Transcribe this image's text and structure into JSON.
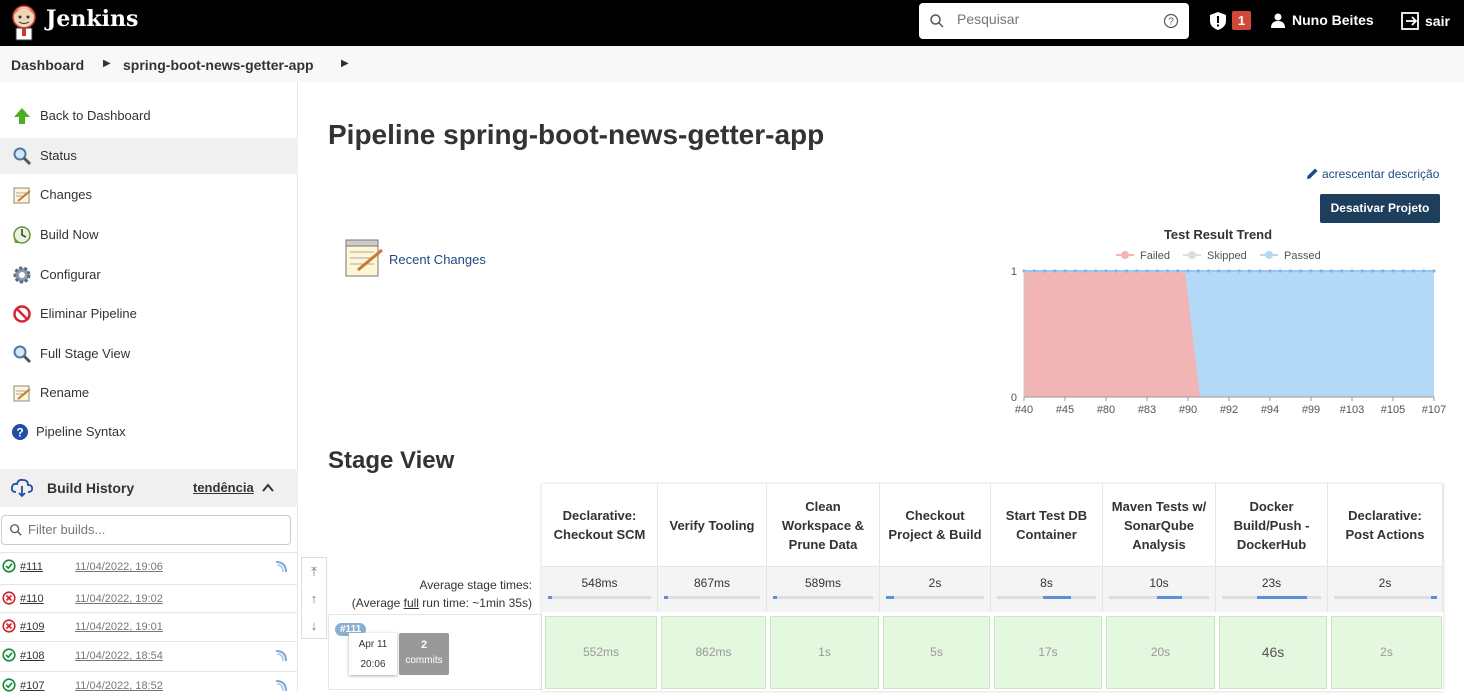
{
  "header": {
    "brand": "Jenkins",
    "search_placeholder": "Pesquisar",
    "alert_count": "1",
    "user": "Nuno Beites",
    "logout": "sair"
  },
  "breadcrumb": [
    "Dashboard",
    "spring-boot-news-getter-app"
  ],
  "sidebar": {
    "tasks": [
      {
        "label": "Back to Dashboard",
        "icon": "up-arrow-icon"
      },
      {
        "label": "Status",
        "icon": "magnifier-icon"
      },
      {
        "label": "Changes",
        "icon": "notepad-icon"
      },
      {
        "label": "Build Now",
        "icon": "clock-icon"
      },
      {
        "label": "Configurar",
        "icon": "gear-icon"
      },
      {
        "label": "Eliminar Pipeline",
        "icon": "no-entry-icon"
      },
      {
        "label": "Full Stage View",
        "icon": "magnifier-icon"
      },
      {
        "label": "Rename",
        "icon": "notepad-icon"
      },
      {
        "label": "Pipeline Syntax",
        "icon": "help-icon"
      }
    ],
    "build_history": {
      "title": "Build History",
      "trend_link": "tendência",
      "filter_placeholder": "Filter builds...",
      "builds": [
        {
          "number": "#111",
          "date": "11/04/2022, 19:06",
          "status": "success"
        },
        {
          "number": "#110",
          "date": "11/04/2022, 19:02",
          "status": "failed"
        },
        {
          "number": "#109",
          "date": "11/04/2022, 19:01",
          "status": "failed"
        },
        {
          "number": "#108",
          "date": "11/04/2022, 18:54",
          "status": "success"
        },
        {
          "number": "#107",
          "date": "11/04/2022, 18:52",
          "status": "success"
        }
      ]
    }
  },
  "main": {
    "title": "Pipeline spring-boot-news-getter-app",
    "add_description": "acrescentar descrição",
    "disable_button": "Desativar Projeto",
    "recent_changes": "Recent Changes",
    "stage_view_title": "Stage View",
    "avg_label_1": "Average stage times:",
    "avg_label_2_pre": "(Average ",
    "avg_label_2_link": "full",
    "avg_label_2_post": " run time: ~1min 35s)",
    "run": {
      "tag": "#111",
      "date": "Apr 11",
      "time": "20:06",
      "commits_count": "2",
      "commits_label": "commits"
    },
    "stages": [
      {
        "name": "Declarative: Checkout SCM",
        "avg": "548ms",
        "avg_fraction": 0.02,
        "run": "552ms"
      },
      {
        "name": "Verify Tooling",
        "avg": "867ms",
        "avg_fraction": 0.02,
        "run": "862ms"
      },
      {
        "name": "Clean Workspace & Prune Data",
        "avg": "589ms",
        "avg_fraction": 0.02,
        "run": "1s"
      },
      {
        "name": "Checkout Project & Build",
        "avg": "2s",
        "avg_fraction": 0.08,
        "run": "5s"
      },
      {
        "name": "Start Test DB Container",
        "avg": "8s",
        "avg_fraction": 0.28,
        "run": "17s"
      },
      {
        "name": "Maven Tests w/ SonarQube Analysis",
        "avg": "10s",
        "avg_fraction": 0.24,
        "run": "20s"
      },
      {
        "name": "Docker Build/Push - DockerHub",
        "avg": "23s",
        "avg_fraction": 0.5,
        "run": "46s"
      },
      {
        "name": "Declarative: Post Actions",
        "avg": "2s",
        "avg_fraction": 0.06,
        "run": "2s"
      }
    ]
  },
  "chart_data": {
    "type": "area",
    "title": "Test Result Trend",
    "legend": [
      "Failed",
      "Skipped",
      "Passed"
    ],
    "legend_position": "top",
    "colors": {
      "Failed": "#f2b5b5",
      "Skipped": "#dddddd",
      "Passed": "#b3d9f7"
    },
    "x_tick_labels": [
      "#40",
      "#45",
      "#80",
      "#83",
      "#90",
      "#92",
      "#94",
      "#99",
      "#103",
      "#105",
      "#107"
    ],
    "y_tick_labels": [
      "0",
      "1"
    ],
    "ylim": [
      0,
      1
    ],
    "series": [
      {
        "name": "Failed",
        "segment_end_tick": "#90",
        "value_before": 1,
        "value_after": 0
      },
      {
        "name": "Skipped",
        "value": 0
      },
      {
        "name": "Passed",
        "segment_start_tick": "#92",
        "value_before": 0,
        "value_after": 1
      }
    ]
  }
}
